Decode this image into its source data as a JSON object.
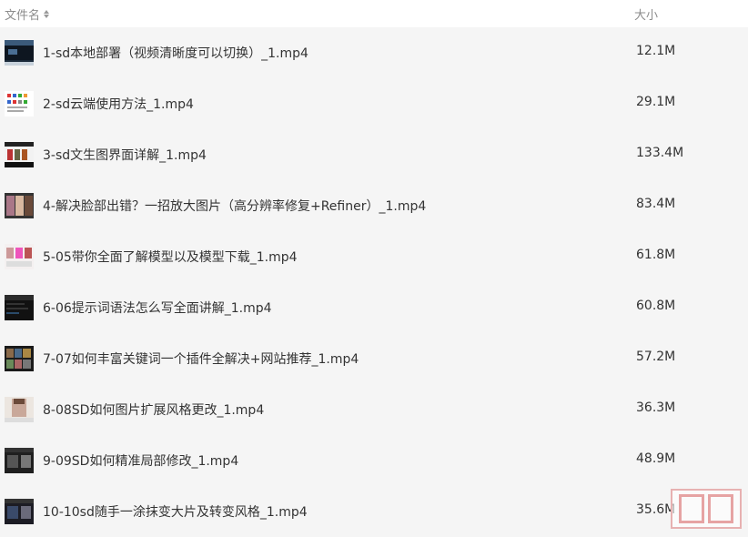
{
  "header": {
    "name_label": "文件名",
    "size_label": "大小"
  },
  "files": [
    {
      "name": "1-sd本地部署（视频清晰度可以切换）_1.mp4",
      "size": "12.1M",
      "thumb": "dark-desktop"
    },
    {
      "name": "2-sd云端使用方法_1.mp4",
      "size": "29.1M",
      "thumb": "white-grid"
    },
    {
      "name": "3-sd文生图界面详解_1.mp4",
      "size": "133.4M",
      "thumb": "white-ui"
    },
    {
      "name": "4-解决脸部出错？一招放大图片（高分辨率修复+Refiner）_1.mp4",
      "size": "83.4M",
      "thumb": "portraits"
    },
    {
      "name": "5-05带你全面了解模型以及模型下载_1.mp4",
      "size": "61.8M",
      "thumb": "white-portraits"
    },
    {
      "name": "6-06提示词语法怎么写全面讲解_1.mp4",
      "size": "60.8M",
      "thumb": "dark-code"
    },
    {
      "name": "7-07如何丰富关键词一个插件全解决+网站推荐_1.mp4",
      "size": "57.2M",
      "thumb": "dark-gallery"
    },
    {
      "name": "8-08SD如何图片扩展风格更改_1.mp4",
      "size": "36.3M",
      "thumb": "light-portrait"
    },
    {
      "name": "9-09SD如何精准局部修改_1.mp4",
      "size": "48.9M",
      "thumb": "dark-ui"
    },
    {
      "name": "10-10sd随手一涂抹变大片及转变风格_1.mp4",
      "size": "35.6M",
      "thumb": "dark-ui-2"
    }
  ],
  "watermark": {
    "icon": "seal-stamp",
    "color": "#e6a3a3"
  }
}
